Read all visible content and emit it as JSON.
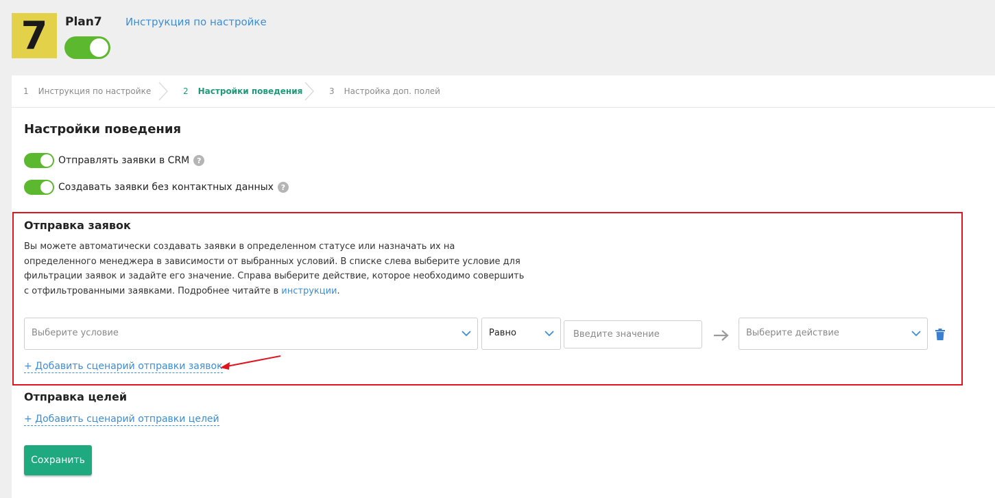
{
  "app": {
    "logo_text": "7",
    "title": "Plan7",
    "help_link": "Инструкция по настройке",
    "enabled": true
  },
  "steps": [
    {
      "num": "1",
      "label": "Инструкция по настройке",
      "active": false
    },
    {
      "num": "2",
      "label": "Настройки поведения",
      "active": true
    },
    {
      "num": "3",
      "label": "Настройка доп. полей",
      "active": false
    }
  ],
  "behavior": {
    "title": "Настройки поведения",
    "toggles": [
      {
        "label": "Отправлять заявки в CRM",
        "on": true
      },
      {
        "label": "Создавать заявки без контактных данных",
        "on": true
      }
    ]
  },
  "leads": {
    "title": "Отправка заявок",
    "description": "Вы можете автоматически создавать заявки в определенном статусе или назначать их на определенного менеджера в зависимости от выбранных условий. В списке слева выберите условие для фильтрации заявок и задайте его значение. Справа выберите действие, которое необходимо совершить с отфильтрованными заявками. Подробнее читайте в",
    "description_link": "инструкции",
    "description_end": ".",
    "rule": {
      "condition_placeholder": "Выберите условие",
      "operator": "Равно",
      "value_placeholder": "Введите значение",
      "action_placeholder": "Выберите действие"
    },
    "add_link": "+ Добавить сценарий отправки заявок"
  },
  "goals": {
    "title": "Отправка целей",
    "add_link": "+ Добавить сценарий отправки целей"
  },
  "save_label": "Сохранить",
  "colors": {
    "accent_green": "#5cb82e",
    "step_active": "#1f9a7a",
    "link_blue": "#3c8dd8",
    "highlight_red": "#e0141e",
    "save_button": "#1fa97e",
    "logo_yellow": "#e4d14a"
  }
}
